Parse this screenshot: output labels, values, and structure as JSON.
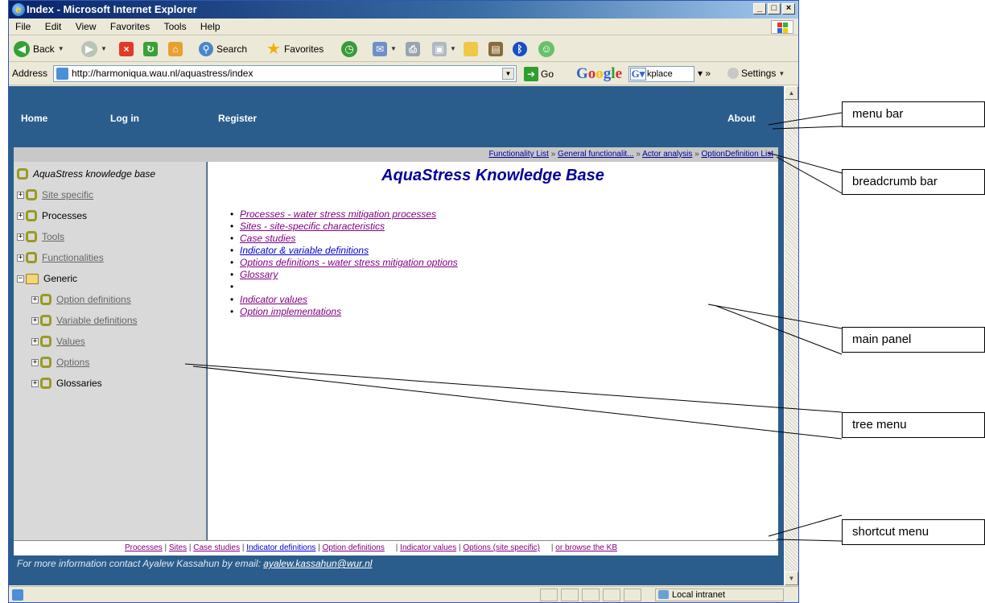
{
  "browser": {
    "title": "Index - Microsoft Internet Explorer",
    "menu": [
      "File",
      "Edit",
      "View",
      "Favorites",
      "Tools",
      "Help"
    ],
    "toolbar": {
      "back": "Back",
      "search": "Search",
      "favorites": "Favorites"
    },
    "address_label": "Address",
    "url": "http://harmoniqua.wau.nl/aquastress/index",
    "go": "Go",
    "google_search_value": "kplace",
    "settings": "Settings",
    "status_zone": "Local intranet"
  },
  "site": {
    "nav": {
      "home": "Home",
      "login": "Log in",
      "register": "Register",
      "about": "About"
    },
    "breadcrumb": [
      "Functionality List",
      "General functionalit...",
      "Actor analysis",
      "OptionDefinition List"
    ],
    "breadcrumb_sep": "»",
    "tree": {
      "root": "AquaStress knowledge base",
      "items": [
        "Site specific",
        "Processes",
        "Tools",
        "Functionalities",
        "Generic"
      ],
      "children": [
        "Option definitions",
        "Variable definitions",
        "Values",
        "Options",
        "Glossaries"
      ]
    },
    "main": {
      "title": "AquaStress Knowledge Base",
      "links": [
        "Processes - water stress mitigation processes",
        "Sites - site-specific characteristics",
        "Case studies",
        "Indicator & variable definitions",
        "Options definitions - water stress mitigation options",
        "Glossary"
      ],
      "links2": [
        "Indicator values",
        "Option implementations"
      ]
    },
    "shortcuts": [
      "Processes",
      "Sites",
      "Case studies",
      "Indicator definitions",
      "Option definitions",
      "Indicator values",
      "Options (site specific)",
      "or browse the KB"
    ],
    "shortcut_sep": "|",
    "contact_text": "For more information contact Ayalew Kassahun by email:",
    "contact_email": "ayalew.kassahun@wur.nl"
  },
  "annotations": [
    "menu bar",
    "breadcrumb bar",
    "main panel",
    "tree menu",
    "shortcut menu"
  ]
}
